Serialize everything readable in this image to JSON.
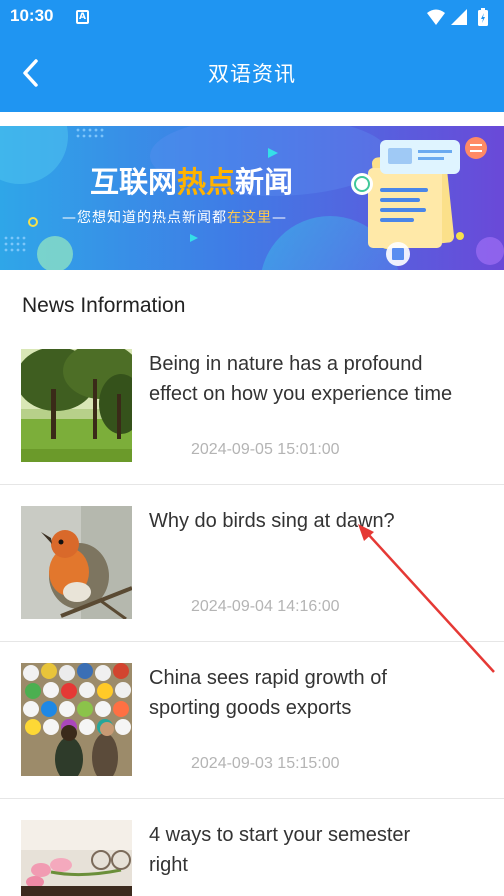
{
  "status_bar": {
    "time": "10:30",
    "notification_icon": "font-a-icon",
    "icons": [
      "wifi-icon",
      "signal-icon",
      "battery-icon"
    ]
  },
  "app_bar": {
    "back_icon": "chevron-left-icon",
    "title": "双语资讯",
    "background_color": "#1f95f2"
  },
  "banner": {
    "headline_plain": "互联网",
    "headline_highlight": "热点",
    "headline_rest": "新闻",
    "tagline_plain": "—您想知道的热点新闻都",
    "tagline_highlight": "在这里",
    "tagline_end": "—"
  },
  "section": {
    "title": "News Information"
  },
  "news": [
    {
      "title_line1": "Being in nature has a profound",
      "title_line2": "effect on how you experience time",
      "date": "2024-09-05 15:01:00",
      "thumbnail": "forest-trees-image"
    },
    {
      "title_line1": "Why do birds sing at dawn?",
      "title_line2": "",
      "date": "2024-09-04 14:16:00",
      "thumbnail": "robin-bird-image"
    },
    {
      "title_line1": "China sees rapid growth of",
      "title_line2": "sporting goods exports",
      "date": "2024-09-03 15:15:00",
      "thumbnail": "soccer-balls-store-image"
    },
    {
      "title_line1": "4 ways to start your semester",
      "title_line2": "right",
      "date": "",
      "thumbnail": "tulips-desk-image"
    }
  ],
  "colors": {
    "accent": "#1f95f2",
    "headline_text": "#333333",
    "date_text": "#b4b4b4",
    "banner_highlight": "#ffb300",
    "annotation_arrow": "#e53935"
  }
}
